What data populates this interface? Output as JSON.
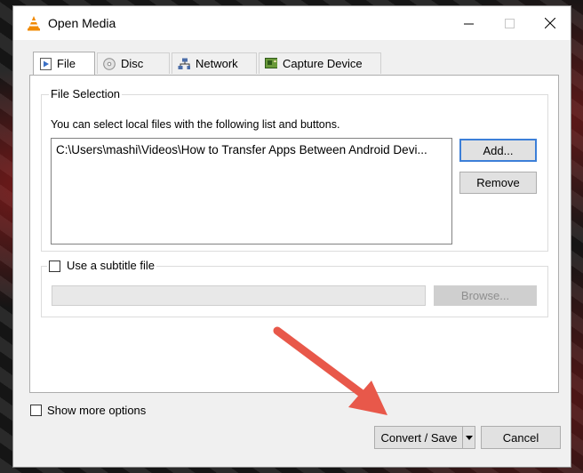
{
  "window": {
    "title": "Open Media"
  },
  "titlebar_icons": {
    "app": "vlc-cone-icon",
    "minimize": "minimize-icon",
    "maximize": "maximize-icon",
    "close": "close-icon"
  },
  "tabs": [
    {
      "label": "File",
      "icon": "file-play-icon",
      "active": true
    },
    {
      "label": "Disc",
      "icon": "disc-icon",
      "active": false
    },
    {
      "label": "Network",
      "icon": "network-icon",
      "active": false
    },
    {
      "label": "Capture Device",
      "icon": "capture-card-icon",
      "active": false
    }
  ],
  "file_selection": {
    "title": "File Selection",
    "hint": "You can select local files with the following list and buttons.",
    "files": [
      "C:\\Users\\mashi\\Videos\\How to Transfer Apps Between Android Devi..."
    ],
    "add_label": "Add...",
    "remove_label": "Remove"
  },
  "subtitle": {
    "checkbox_label": "Use a subtitle file",
    "checked": false,
    "path_value": "",
    "browse_label": "Browse..."
  },
  "show_more": {
    "label": "Show more options",
    "checked": false
  },
  "footer": {
    "convert_label": "Convert / Save",
    "cancel_label": "Cancel"
  },
  "colors": {
    "accent_border": "#3c7fd8",
    "annotation_arrow": "#e8584a",
    "vlc_orange": "#f08a00"
  }
}
